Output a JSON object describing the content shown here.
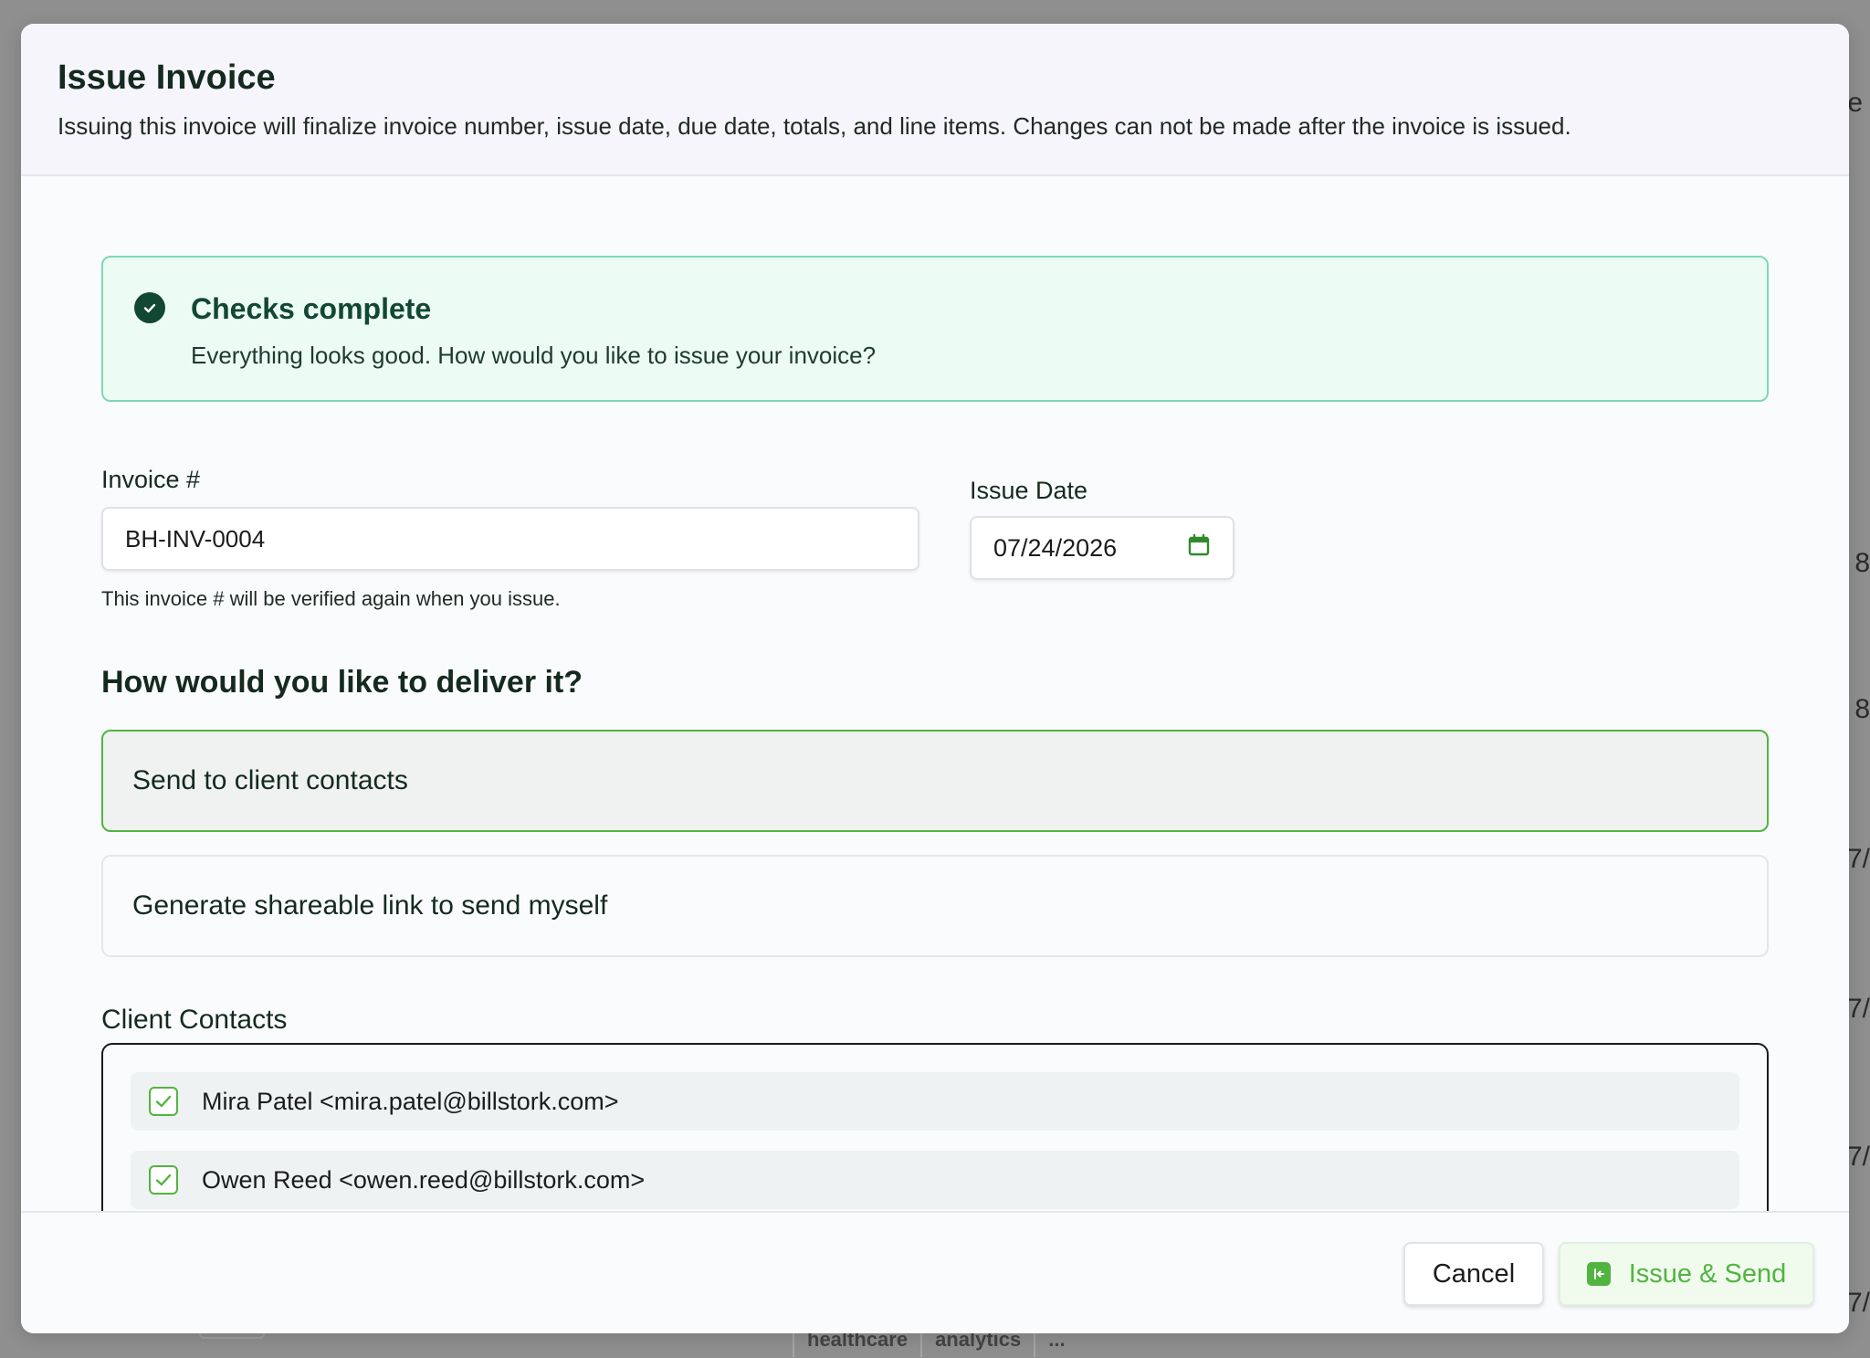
{
  "background": {
    "edge_texts": [
      "e",
      "8",
      "8",
      "7/",
      "7/",
      "7/",
      "7/"
    ],
    "tags": [
      "healthcare",
      "analytics",
      "..."
    ]
  },
  "modal": {
    "title": "Issue Invoice",
    "description": "Issuing this invoice will finalize invoice number, issue date, due date, totals, and line items. Changes can not be made after the invoice is issued."
  },
  "alert": {
    "title": "Checks complete",
    "text": "Everything looks good. How would you like to issue your invoice?",
    "icon": "check-circle-icon",
    "color": "#124734"
  },
  "invoice": {
    "label": "Invoice #",
    "value": "BH-INV-0004",
    "hint": "This invoice # will be verified again when you issue."
  },
  "issue_date": {
    "label": "Issue Date",
    "value": "07/24/2026",
    "icon": "calendar-icon"
  },
  "delivery": {
    "title": "How would you like to deliver it?",
    "options": [
      {
        "label": "Send to client contacts",
        "selected": true
      },
      {
        "label": "Generate shareable link to send myself",
        "selected": false
      }
    ]
  },
  "contacts": {
    "label": "Client Contacts",
    "items": [
      {
        "label": "Mira Patel <mira.patel@billstork.com>",
        "checked": true
      },
      {
        "label": "Owen Reed <owen.reed@billstork.com>",
        "checked": true
      }
    ]
  },
  "footer": {
    "cancel_label": "Cancel",
    "issue_label": "Issue & Send",
    "accent": "#52b440"
  }
}
